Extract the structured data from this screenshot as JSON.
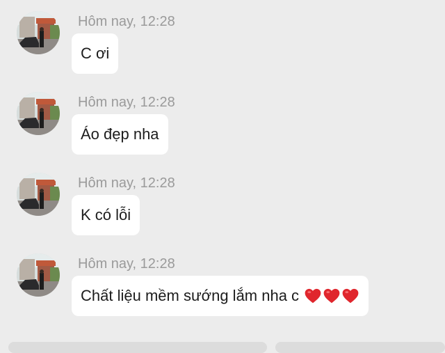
{
  "messages": [
    {
      "timestamp": "Hôm nay, 12:28",
      "text": "C ơi",
      "hearts": 0
    },
    {
      "timestamp": "Hôm nay, 12:28",
      "text": "Áo đẹp nha",
      "hearts": 0
    },
    {
      "timestamp": "Hôm nay, 12:28",
      "text": "K có lỗi",
      "hearts": 0
    },
    {
      "timestamp": "Hôm nay, 12:28",
      "text": "Chất liệu mềm sướng lắm nha c",
      "hearts": 3
    }
  ],
  "icons": {
    "avatar": "profile-photo-house-car",
    "heart": "red-heart-emoji"
  },
  "colors": {
    "background": "#ececec",
    "bubble": "#ffffff",
    "timestamp": "#9a9a9a",
    "text": "#1c1c1c",
    "heart": "#e0262d"
  }
}
